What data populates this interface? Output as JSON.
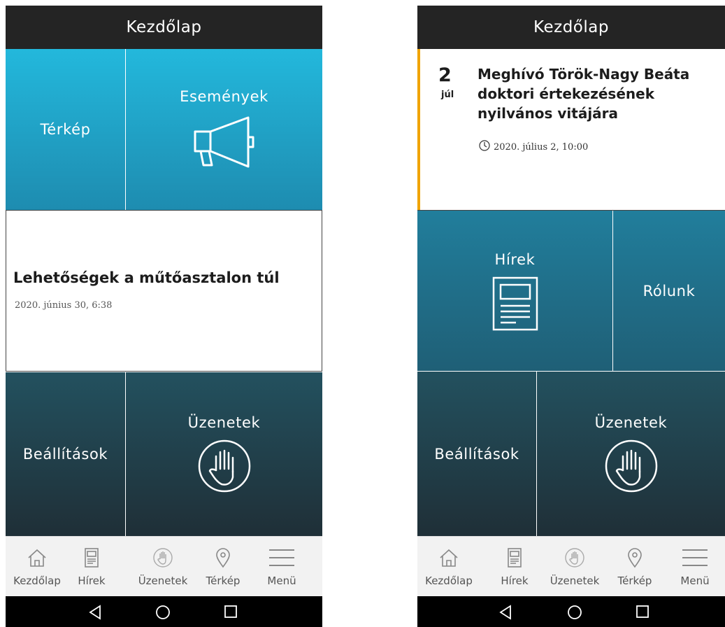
{
  "left_screen": {
    "header": {
      "title": "Kezdőlap"
    },
    "tiles": {
      "map": "Térkép",
      "events": "Események",
      "settings": "Beállítások",
      "messages": "Üzenetek"
    },
    "news": {
      "title": "Lehetőségek a műtőasztalon túl",
      "date": "2020. június 30, 6:38"
    }
  },
  "right_screen": {
    "header": {
      "title": "Kezdőlap"
    },
    "event": {
      "day": "2",
      "month": "júl",
      "title_line1": "Meghívó Török-Nagy Beáta",
      "title_line2": "doktori értekezésének",
      "title_line3": "nyilvános vitájára",
      "time": "2020. július 2, 10:00"
    },
    "tiles": {
      "news": "Hírek",
      "about": "Rólunk",
      "settings": "Beállítások",
      "messages": "Üzenetek"
    }
  },
  "bottom_nav": {
    "items": [
      {
        "label": "Kezdőlap",
        "icon": "home-icon"
      },
      {
        "label": "Hírek",
        "icon": "newspaper-icon"
      },
      {
        "label": "Üzenetek",
        "icon": "hand-icon"
      },
      {
        "label": "Térkép",
        "icon": "map-pin-icon"
      },
      {
        "label": "Menü",
        "icon": "hamburger-icon"
      }
    ]
  },
  "system_nav": {
    "icons": [
      "back-icon",
      "home-circle-icon",
      "recents-icon"
    ]
  },
  "colors": {
    "header_bg": "#242424",
    "tile_top": "#23b8dc",
    "tile_bottom": "#1f2f37",
    "event_accent": "#f0a400",
    "nav_bg": "#f2f2f2"
  }
}
